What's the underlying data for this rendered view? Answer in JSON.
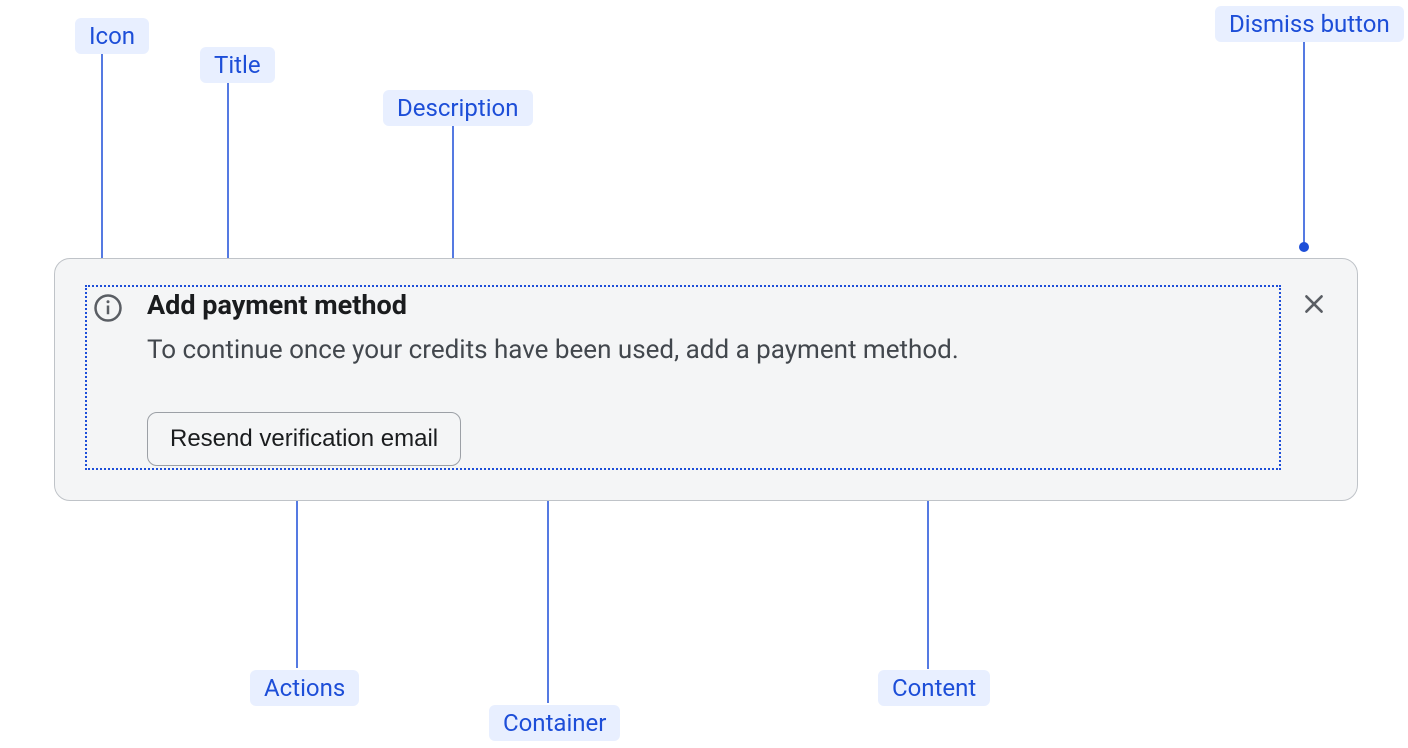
{
  "labels": {
    "icon": "Icon",
    "title": "Title",
    "description": "Description",
    "dismiss": "Dismiss button",
    "actions": "Actions",
    "container": "Container",
    "content": "Content"
  },
  "banner": {
    "title": "Add payment method",
    "description": "To continue once your credits have been used, add a payment method.",
    "action_label": "Resend verification email"
  },
  "colors": {
    "label_bg": "#e8efff",
    "label_fg": "#1d4ed8",
    "line": "#1d4ed8",
    "container_border": "#bfc3c8",
    "container_bg": "#f4f5f6",
    "text_primary": "#1a1c1e",
    "text_secondary": "#42474d"
  }
}
